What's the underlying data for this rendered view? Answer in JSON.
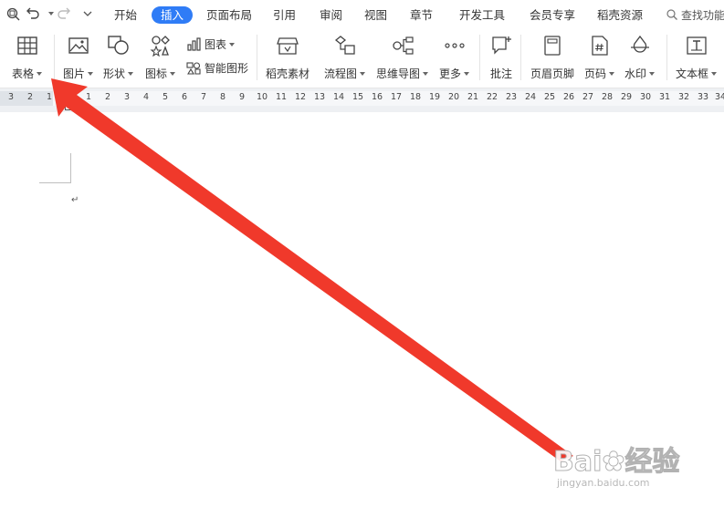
{
  "menu": {
    "tabs": [
      {
        "label": "开始",
        "active": false
      },
      {
        "label": "插入",
        "active": true
      },
      {
        "label": "页面布局",
        "active": false
      },
      {
        "label": "引用",
        "active": false
      },
      {
        "label": "审阅",
        "active": false
      },
      {
        "label": "视图",
        "active": false
      },
      {
        "label": "章节",
        "active": false
      },
      {
        "label": "开发工具",
        "active": false
      },
      {
        "label": "会员专享",
        "active": false
      },
      {
        "label": "稻壳资源",
        "active": false
      }
    ],
    "search_label": "查找功能",
    "quick_access": [
      "print-preview-icon",
      "undo-icon",
      "redo-icon",
      "customize-dropdown-icon"
    ]
  },
  "ribbon": {
    "table": "表格",
    "picture": "图片",
    "shape": "形状",
    "icon": "图标",
    "chart": "图表",
    "smart_art": "智能图形",
    "docer_material": "稻壳素材",
    "flowchart": "流程图",
    "mind_map": "思维导图",
    "more": "更多",
    "comment": "批注",
    "header_footer": "页眉页脚",
    "page_number": "页码",
    "watermark": "水印",
    "text_box": "文本框"
  },
  "ruler": {
    "ticks": [
      "3",
      "2",
      "1",
      "1",
      "2",
      "3",
      "4",
      "5",
      "6",
      "7",
      "8",
      "9",
      "10",
      "11",
      "12",
      "13",
      "14",
      "15",
      "16",
      "17",
      "18",
      "19",
      "20",
      "21",
      "22",
      "23",
      "24",
      "25",
      "26",
      "27",
      "28",
      "29",
      "30",
      "31",
      "32",
      "33",
      "34"
    ]
  },
  "document": {
    "paragraph_mark": "↵"
  },
  "annotation": {
    "arrow_color": "#f0392b"
  },
  "watermark": {
    "brand": "Bai",
    "brand2": "经验",
    "url": "jingyan.baidu.com"
  },
  "colors": {
    "accent": "#2f7cf6"
  }
}
